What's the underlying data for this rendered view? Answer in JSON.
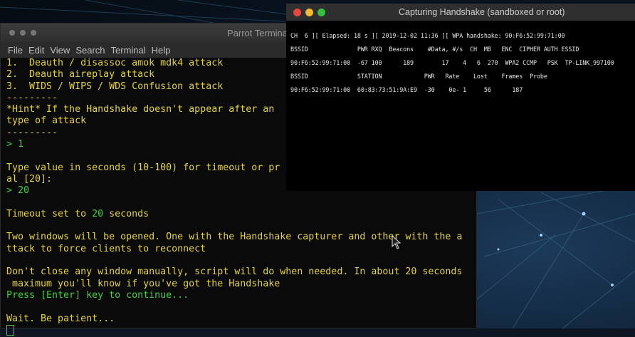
{
  "terminal": {
    "title": "Parrot Termina",
    "menu": [
      "File",
      "Edit",
      "View",
      "Search",
      "Terminal",
      "Help"
    ],
    "lines": [
      {
        "c": "y",
        "t": "1.  Deauth / disassoc amok mdk4 attack"
      },
      {
        "c": "y",
        "t": "2.  Deauth aireplay attack"
      },
      {
        "c": "y",
        "t": "3.  WIDS / WIPS / WDS Confusion attack"
      },
      {
        "c": "y",
        "t": "---------"
      },
      {
        "c": "y",
        "t": "*Hint* If the Handshake doesn't appear after an"
      },
      {
        "c": "y",
        "t": "type of attack"
      },
      {
        "c": "y",
        "t": "---------"
      },
      {
        "c": "g",
        "t": "> 1"
      },
      {
        "c": "w",
        "t": ""
      },
      {
        "c": "y",
        "t": "Type value in seconds (10-100) for timeout or pr"
      },
      {
        "c": "y",
        "t": "al [20]:"
      },
      {
        "c": "g",
        "t": "> 20"
      },
      {
        "c": "w",
        "t": ""
      },
      {
        "c": "mix",
        "parts": [
          {
            "c": "y",
            "t": "Timeout set to "
          },
          {
            "c": "g",
            "t": "20"
          },
          {
            "c": "y",
            "t": " seconds"
          }
        ]
      },
      {
        "c": "w",
        "t": ""
      },
      {
        "c": "y",
        "t": "Two windows will be opened. One with the Handshake capturer and other with the a"
      },
      {
        "c": "y",
        "t": "ttack to force clients to reconnect"
      },
      {
        "c": "w",
        "t": ""
      },
      {
        "c": "y",
        "t": "Don't close any window manually, script will do when needed. In about 20 seconds"
      },
      {
        "c": "y",
        "t": " maximum you'll know if you've got the Handshake"
      },
      {
        "c": "g",
        "t": "Press [Enter] key to continue..."
      },
      {
        "c": "w",
        "t": ""
      },
      {
        "c": "y",
        "t": "Wait. Be patient..."
      }
    ]
  },
  "capture": {
    "title": "Capturing Handshake (sandboxed or root)",
    "lines": [
      "CH  6 ][ Elapsed: 18 s ][ 2019-12-02 11:36 ][ WPA handshake: 90:F6:52:99:71:00",
      "",
      "BSSID              PWR RXQ  Beacons    #Data, #/s  CH  MB   ENC  CIPHER AUTH ESSID",
      "",
      "90:F6:52:99:71:00  -67 100      189        17    4   6  270  WPA2 CCMP   PSK  TP-LINK_997100",
      "",
      "BSSID              STATION            PWR   Rate    Lost    Frames  Probe",
      "",
      "90:F6:52:99:71:00  60:83:73:51:9A:E9  -30    0e- 1     56      187"
    ]
  },
  "colors": {
    "yellow": "#e6d33a",
    "green": "#41d13d",
    "close": "#e7473c",
    "minimize": "#f0b92f",
    "maximize": "#35c13f"
  }
}
